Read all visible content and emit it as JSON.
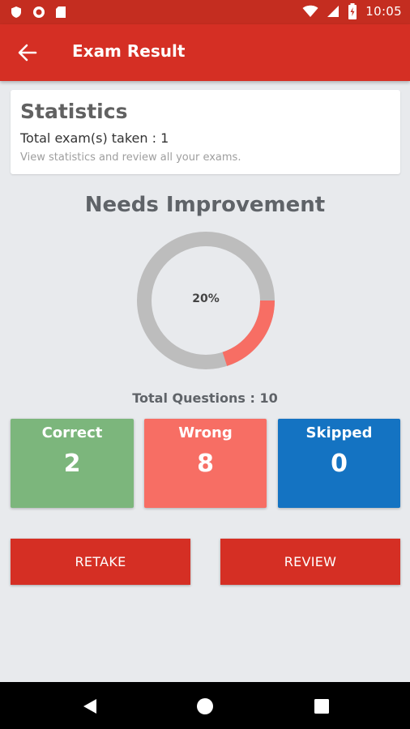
{
  "status_bar": {
    "time": "10:05",
    "icons": [
      "shield-icon",
      "record-icon",
      "sd-card-icon",
      "wifi-icon",
      "signal-icon",
      "battery-icon"
    ]
  },
  "app_bar": {
    "title": "Exam Result",
    "back_icon": "arrow-back-icon"
  },
  "statistics": {
    "title": "Statistics",
    "total_taken": "Total exam(s) taken : 1",
    "description": "View statistics and review all your exams."
  },
  "result": {
    "verdict": "Needs Improvement",
    "percent_label": "20%",
    "percent": 20,
    "total_questions": "Total Questions : 10",
    "colors": {
      "correct_arc": "#f76e64",
      "remaining_arc": "#bdbdbd"
    }
  },
  "tiles": {
    "correct": {
      "label": "Correct",
      "value": "2",
      "color": "#7cb67c"
    },
    "wrong": {
      "label": "Wrong",
      "value": "8",
      "color": "#f76e64"
    },
    "skipped": {
      "label": "Skipped",
      "value": "0",
      "color": "#1473c2"
    }
  },
  "buttons": {
    "retake": "RETAKE",
    "review": "REVIEW",
    "color": "#d52f24"
  },
  "nav_bar": {
    "icons": [
      "back-triangle-icon",
      "home-circle-icon",
      "recents-square-icon"
    ]
  }
}
